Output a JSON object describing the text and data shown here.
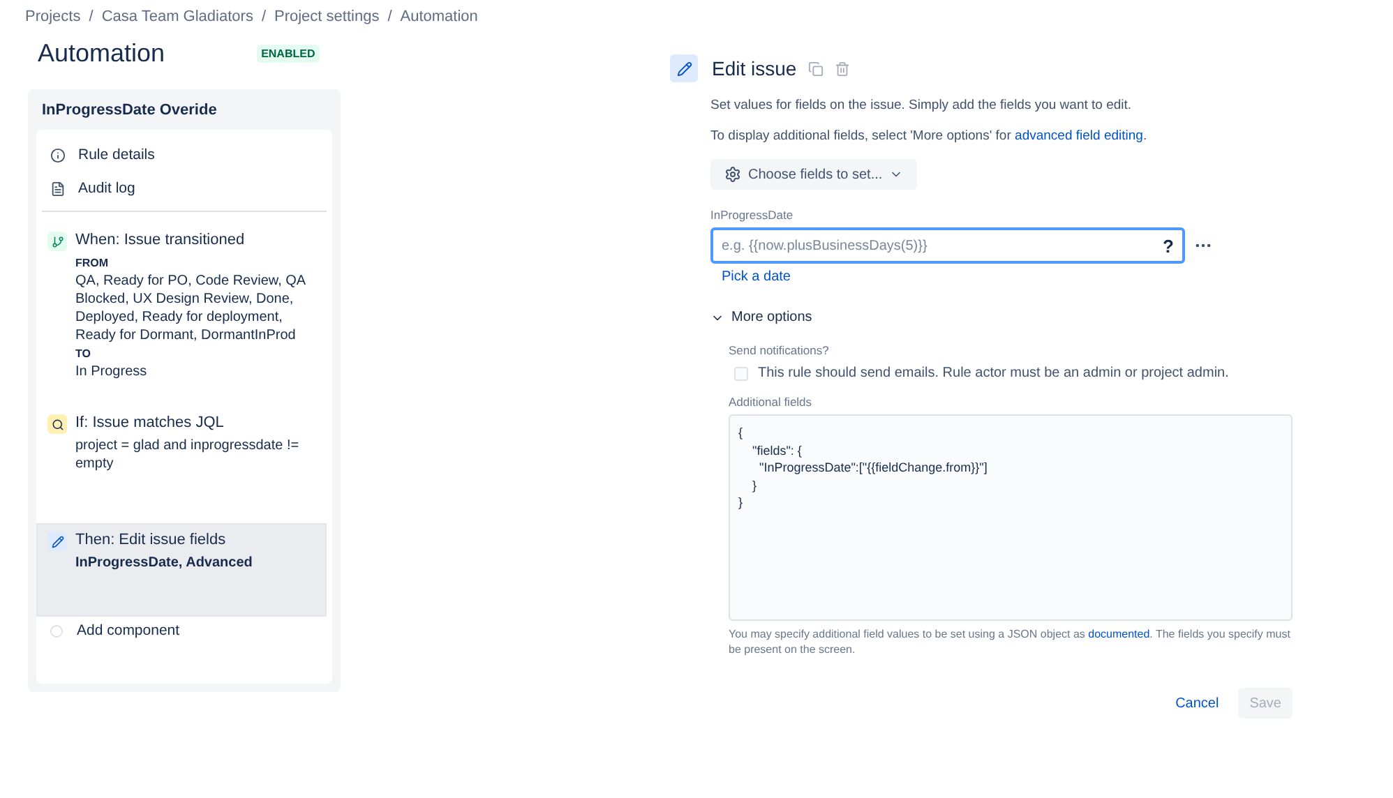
{
  "breadcrumbs": [
    "Projects",
    "Casa Team Gladiators",
    "Project settings",
    "Automation"
  ],
  "breadcrumb_separator": "/",
  "page": {
    "title": "Automation",
    "status": "ENABLED"
  },
  "rule": {
    "name": "InProgressDate Overide",
    "menu": [
      {
        "kind": "info",
        "label": "Rule details"
      },
      {
        "kind": "log",
        "label": "Audit log"
      }
    ],
    "steps": [
      {
        "kind": "trigger",
        "title": "When: Issue transitioned",
        "selected": false,
        "lines": [
          {
            "kind": "caption",
            "text": "FROM"
          },
          {
            "kind": "text",
            "text": "QA, Ready for PO, Code Review, QA Blocked, UX Design Review, Done, Deployed, Ready for deployment, Ready for Dormant, DormantInProd"
          },
          {
            "kind": "caption",
            "text": "TO"
          },
          {
            "kind": "text",
            "text": "In Progress"
          }
        ]
      },
      {
        "kind": "condition",
        "title": "If: Issue matches JQL",
        "selected": false,
        "lines": [
          {
            "kind": "text",
            "text": "project = glad and inprogressdate != empty"
          }
        ]
      },
      {
        "kind": "action",
        "title": "Then: Edit issue fields",
        "selected": true,
        "lines": [
          {
            "kind": "bold",
            "text": "InProgressDate, Advanced"
          }
        ]
      }
    ],
    "add_label": "Add component"
  },
  "editor": {
    "title": "Edit issue",
    "intro": "Set values for fields on the issue. Simply add the fields you want to edit.",
    "hint": {
      "before": "To display additional fields, select 'More options' for ",
      "link": "advanced field editing",
      "after": "."
    },
    "choose_button": "Choose fields to set...",
    "field": {
      "label": "InProgressDate",
      "placeholder": "e.g. {{now.plusBusinessDays(5)}}",
      "help": "?",
      "link": "Pick a date"
    },
    "more_options": {
      "label": "More options",
      "expanded": true,
      "notify_label": "Send notifications?",
      "notify_text": "This rule should send emails. Rule actor must be an admin or project admin.",
      "notify_checked": false,
      "additional_label": "Additional fields",
      "code": [
        "{",
        "    \"fields\": {",
        "      \"InProgressDate\":[\"{{fieldChange.from}}\"]",
        "    }",
        "}"
      ],
      "note": {
        "before": "You may specify additional field values to be set using a JSON object as ",
        "link": "documented",
        "after": ". The fields you specify must be present on the screen."
      }
    },
    "buttons": [
      {
        "kind": "link",
        "label": "Cancel",
        "disabled": false
      },
      {
        "kind": "primary",
        "label": "Save",
        "disabled": true
      }
    ]
  }
}
